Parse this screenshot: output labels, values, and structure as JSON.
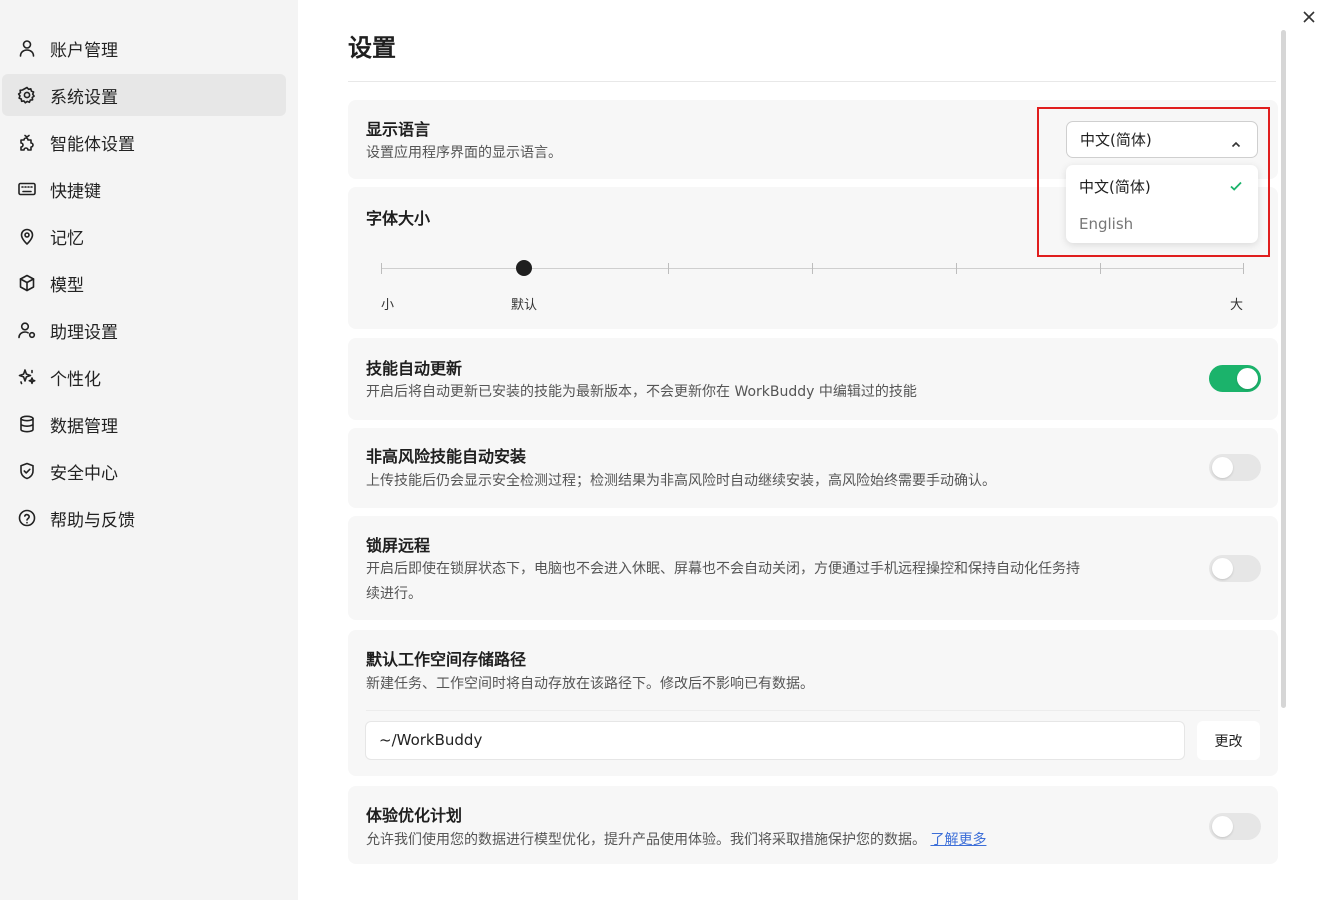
{
  "sidebar": {
    "items": [
      {
        "label": "账户管理",
        "icon": "user-icon"
      },
      {
        "label": "系统设置",
        "icon": "gear-icon",
        "active": true
      },
      {
        "label": "智能体设置",
        "icon": "puzzle-icon"
      },
      {
        "label": "快捷键",
        "icon": "keyboard-icon"
      },
      {
        "label": "记忆",
        "icon": "location-pin-icon"
      },
      {
        "label": "模型",
        "icon": "cube-icon"
      },
      {
        "label": "助理设置",
        "icon": "user-gear-icon"
      },
      {
        "label": "个性化",
        "icon": "sparkle-icon"
      },
      {
        "label": "数据管理",
        "icon": "database-icon"
      },
      {
        "label": "安全中心",
        "icon": "shield-icon"
      },
      {
        "label": "帮助与反馈",
        "icon": "help-icon"
      }
    ]
  },
  "header": {
    "title": "设置",
    "close_icon": "close-icon"
  },
  "settings": {
    "language": {
      "title": "显示语言",
      "desc": "设置应用程序界面的显示语言。",
      "selected": "中文(简体)",
      "options": [
        "中文(简体)",
        "English"
      ]
    },
    "font_size": {
      "title": "字体大小",
      "labels": {
        "small": "小",
        "default": "默认",
        "large": "大"
      },
      "level_index": 1,
      "steps": 7
    },
    "skill_update": {
      "title": "技能自动更新",
      "desc": "开启后将自动更新已安装的技能为最新版本，不会更新你在 WorkBuddy 中编辑过的技能",
      "enabled": true
    },
    "skill_install": {
      "title": "非高风险技能自动安装",
      "desc": "上传技能后仍会显示安全检测过程；检测结果为非高风险时自动继续安装，高风险始终需要手动确认。",
      "enabled": false
    },
    "lock_remote": {
      "title": "锁屏远程",
      "desc": "开启后即使在锁屏状态下，电脑也不会进入休眠、屏幕也不会自动关闭，方便通过手机远程操控和保持自动化任务持续进行。",
      "enabled": false
    },
    "workspace_path": {
      "title": "默认工作空间存储路径",
      "desc": "新建任务、工作空间时将自动存放在该路径下。修改后不影响已有数据。",
      "value": "~/WorkBuddy",
      "button": "更改"
    },
    "experience": {
      "title": "体验优化计划",
      "desc": "允许我们使用您的数据进行模型优化，提升产品使用体验。我们将采取措施保护您的数据。",
      "link": "了解更多",
      "enabled": false
    }
  },
  "colors": {
    "accent_green": "#1bb36b",
    "highlight_red": "#e01e1e",
    "link_blue": "#3d6fd8"
  }
}
